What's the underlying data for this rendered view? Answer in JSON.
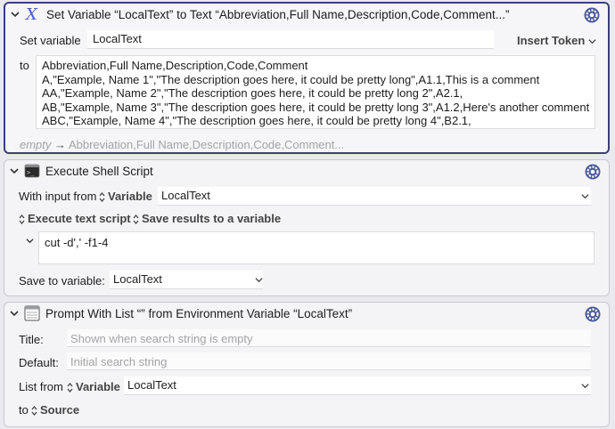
{
  "set_variable": {
    "title": "Set Variable “LocalText” to Text “Abbreviation,Full Name,Description,Code,Comment...”",
    "set_variable_label": "Set variable",
    "variable_value": "LocalText",
    "insert_token_label": "Insert Token",
    "to_label": "to",
    "text_lines": [
      "Abbreviation,Full Name,Description,Code,Comment",
      "A,\"Example, Name 1\",\"The description goes here, it could be pretty long\",A1.1,This is a comment",
      "AA,\"Example, Name 2\",\"The description goes here, it could be pretty long 2\",A2.1,",
      "AB,\"Example, Name 3\",\"The description goes here, it could be pretty long 3\",A1.2,Here's another comment",
      "ABC,\"Example, Name 4\",\"The description goes here, it could be pretty long 4\",B2.1,"
    ],
    "preview_empty": "empty",
    "preview_arrow": "→",
    "preview_text": "Abbreviation,Full Name,Description,Code,Comment..."
  },
  "shell_script": {
    "title": "Execute Shell Script",
    "with_input_label": "With input from",
    "input_source": "Variable",
    "input_variable": "LocalText",
    "execute_mode": "Execute text script",
    "result_mode": "Save results to a variable",
    "script": "cut -d',' -f1-4",
    "save_to_label": "Save to variable:",
    "save_variable": "LocalText"
  },
  "prompt_list": {
    "title": "Prompt With List “” from Environment Variable “LocalText”",
    "title_label": "Title:",
    "title_placeholder": "Shown when search string is empty",
    "default_label": "Default:",
    "default_placeholder": "Initial search string",
    "list_from_label": "List from",
    "list_source": "Variable",
    "list_variable": "LocalText",
    "to_label": "to",
    "to_value": "Source"
  },
  "icons": [
    "chevron-down-icon",
    "variable-x-icon",
    "terminal-icon",
    "window-list-icon",
    "gear-icon",
    "updown-icon"
  ],
  "colors": {
    "selected_border": "#3a3f7d",
    "variable_icon": "#4a5bd0"
  }
}
